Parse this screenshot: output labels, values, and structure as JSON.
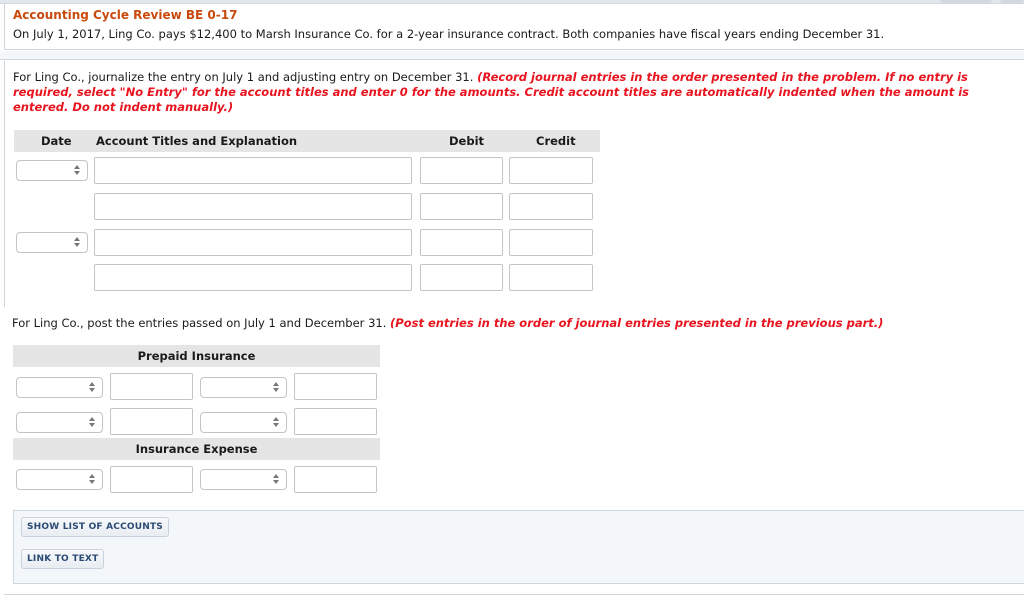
{
  "problem": {
    "title": "Accounting Cycle Review BE 0-17",
    "text": "On July 1, 2017, Ling Co. pays $12,400 to Marsh Insurance Co. for a 2-year insurance contract. Both companies have fiscal years ending December 31."
  },
  "partA": {
    "instruction": "For Ling Co., journalize the entry on July 1 and adjusting entry on December 31.",
    "instruction_red": "(Record journal entries in the order presented in the problem. If no entry is required, select \"No Entry\" for the account titles and enter 0 for the amounts. Credit account titles are automatically indented when the amount is entered. Do not indent manually.)",
    "columns": {
      "date": "Date",
      "account": "Account Titles and Explanation",
      "debit": "Debit",
      "credit": "Credit"
    },
    "rows": [
      {
        "date": "",
        "account": "",
        "debit": "",
        "credit": ""
      },
      {
        "account": "",
        "debit": "",
        "credit": ""
      },
      {
        "date": "",
        "account": "",
        "debit": "",
        "credit": ""
      },
      {
        "account": "",
        "debit": "",
        "credit": ""
      }
    ]
  },
  "partB": {
    "instruction": "For Ling Co., post the entries passed on July 1 and December 31.",
    "instruction_red": "(Post entries in the order of journal entries presented in the previous part.)",
    "accounts": [
      {
        "name": "Prepaid Insurance",
        "rows": 2
      },
      {
        "name": "Insurance Expense",
        "rows": 1
      }
    ]
  },
  "buttons": {
    "show_list": "SHOW LIST OF ACCOUNTS",
    "link_text": "LINK TO TEXT"
  }
}
